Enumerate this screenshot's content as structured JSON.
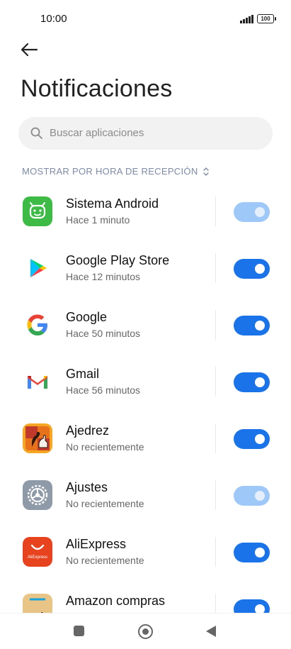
{
  "status_bar": {
    "time": "10:00",
    "battery": "100"
  },
  "header": {
    "title": "Notificaciones"
  },
  "search": {
    "placeholder": "Buscar aplicaciones"
  },
  "sort": {
    "label": "MOSTRAR POR HORA DE RECEPCIÓN"
  },
  "apps": [
    {
      "name": "Sistema Android",
      "subtitle": "Hace 1 minuto",
      "enabled": true,
      "locked": true,
      "icon": "android-icon",
      "color": "#3dbb46"
    },
    {
      "name": "Google Play Store",
      "subtitle": "Hace 12 minutos",
      "enabled": true,
      "locked": false,
      "icon": "play-store-icon"
    },
    {
      "name": "Google",
      "subtitle": "Hace 50 minutos",
      "enabled": true,
      "locked": false,
      "icon": "google-icon"
    },
    {
      "name": "Gmail",
      "subtitle": "Hace 56 minutos",
      "enabled": true,
      "locked": false,
      "icon": "gmail-icon"
    },
    {
      "name": "Ajedrez",
      "subtitle": "No recientemente",
      "enabled": true,
      "locked": false,
      "icon": "chess-icon",
      "color": "#f08a1c"
    },
    {
      "name": "Ajustes",
      "subtitle": "No recientemente",
      "enabled": true,
      "locked": true,
      "icon": "settings-icon",
      "color": "#8f9aa8"
    },
    {
      "name": "AliExpress",
      "subtitle": "No recientemente",
      "enabled": true,
      "locked": false,
      "icon": "aliexpress-icon",
      "color": "#e8431f",
      "icon_text": "AliExpress"
    },
    {
      "name": "Amazon compras",
      "subtitle": "",
      "enabled": true,
      "locked": false,
      "icon": "amazon-icon",
      "color": "#f3d7a3"
    }
  ],
  "colors": {
    "toggle_on": "#1a73e8",
    "toggle_locked": "#9ec8f7",
    "accent_text": "#7c8aa6"
  }
}
